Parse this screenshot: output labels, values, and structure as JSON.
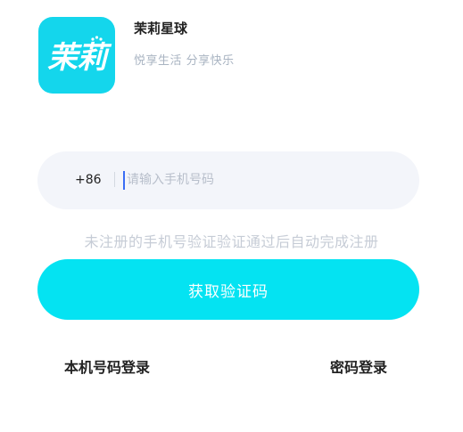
{
  "header": {
    "logo_text": "茉莉",
    "app_name": "茉莉星球",
    "slogan": "悦享生活  分享快乐"
  },
  "phone_form": {
    "country_code": "+86",
    "placeholder": "请输入手机号码",
    "value": ""
  },
  "notice": "未注册的手机号验证验证通过后自动完成注册",
  "actions": {
    "get_code_label": "获取验证码",
    "one_click_login_label": "本机号码登录",
    "password_login_label": "密码登录"
  },
  "colors": {
    "accent": "#04e3f2",
    "logo_bg": "#14d6ec",
    "field_bg": "#f3f5fa",
    "muted_text": "#a9b4c2",
    "caret": "#3a6df5"
  }
}
